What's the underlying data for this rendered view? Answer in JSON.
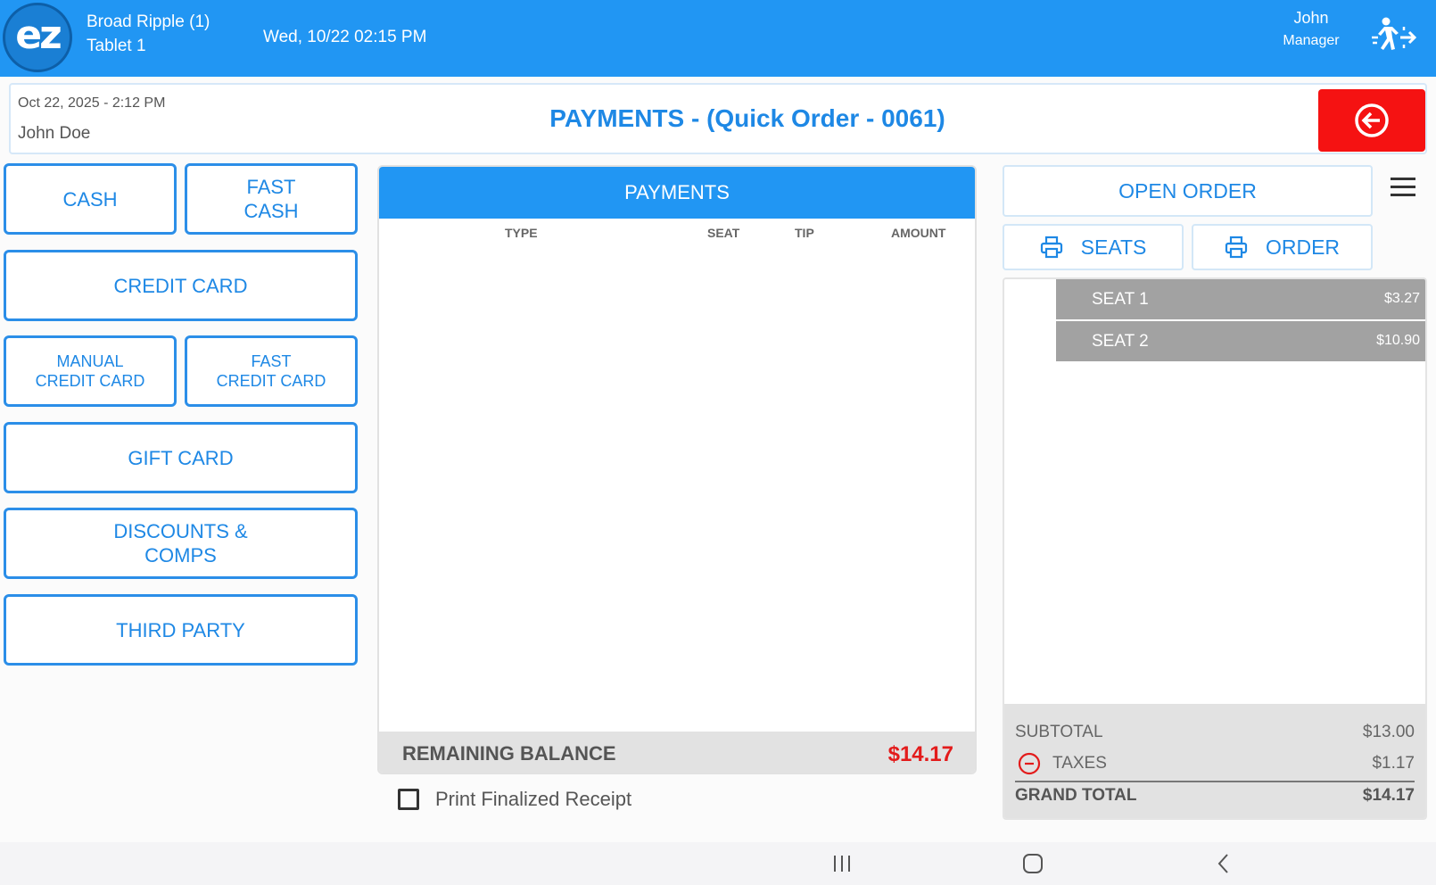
{
  "topbar": {
    "logo_text": "ez",
    "location": "Broad Ripple (1)",
    "device": "Tablet 1",
    "datetime": "Wed, 10/22 02:15 PM",
    "user_name": "John",
    "user_role": "Manager"
  },
  "header": {
    "date": "Oct 22, 2025  - 2:12 PM",
    "customer": "John Doe",
    "title": "PAYMENTS - (Quick Order - 0061)"
  },
  "payment_buttons": {
    "cash": "CASH",
    "fast_cash": [
      "FAST",
      "CASH"
    ],
    "credit_card": "CREDIT CARD",
    "manual_credit_card": [
      "MANUAL",
      "CREDIT CARD"
    ],
    "fast_credit_card": [
      "FAST",
      "CREDIT CARD"
    ],
    "gift_card": "GIFT CARD",
    "discounts_comps": [
      "DISCOUNTS &",
      "COMPS"
    ],
    "third_party": "THIRD PARTY"
  },
  "payments_table": {
    "title": "PAYMENTS",
    "columns": [
      "TYPE",
      "SEAT",
      "TIP",
      "AMOUNT"
    ],
    "remaining_label": "REMAINING BALANCE",
    "remaining_value": "$14.17"
  },
  "print_receipt": {
    "label": "Print Finalized Receipt",
    "checked": false
  },
  "order_panel": {
    "open_order": "OPEN ORDER",
    "seats_print": "SEATS",
    "order_print": "ORDER",
    "seats": [
      {
        "name": "SEAT 1",
        "amount": "$3.27"
      },
      {
        "name": "SEAT 2",
        "amount": "$10.90"
      }
    ],
    "subtotal_label": "SUBTOTAL",
    "subtotal_value": "$13.00",
    "taxes_label": "TAXES",
    "taxes_value": "$1.17",
    "grand_total_label": "GRAND TOTAL",
    "grand_total_value": "$14.17"
  },
  "colors": {
    "brand_blue": "#2196f3",
    "back_red": "#f51212",
    "balance_red": "#e31b1b"
  },
  "icons": [
    "logout-icon",
    "back-arrow-icon",
    "printer-icon",
    "menu-icon",
    "minus-circle-icon",
    "recent-apps-icon",
    "home-icon",
    "back-nav-icon"
  ]
}
